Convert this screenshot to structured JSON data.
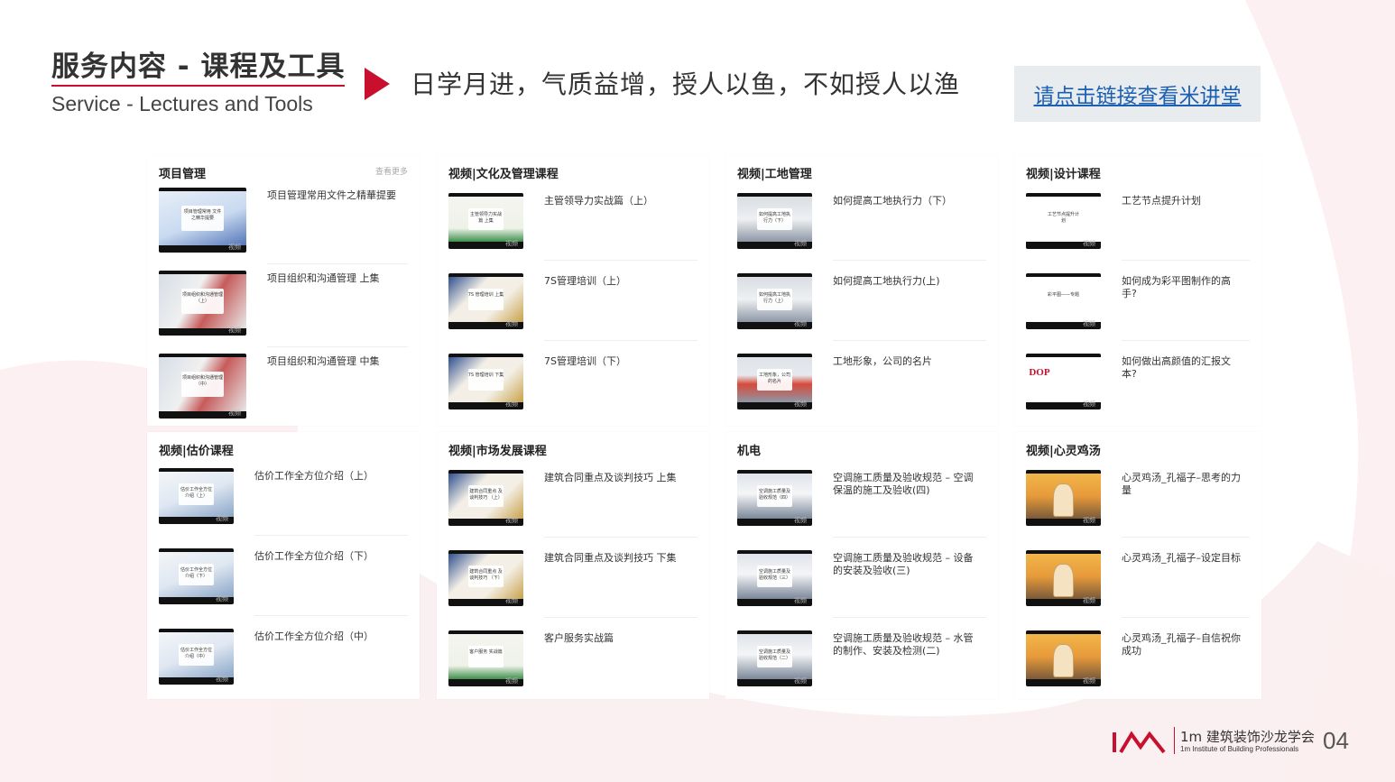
{
  "header": {
    "title_cn": "服务内容 - 课程及工具",
    "title_en": "Service - Lectures and Tools",
    "slogan": "日学月进，气质益增，授人以鱼，不如授人以渔",
    "link_text": "请点击链接查看米讲堂"
  },
  "colors": {
    "accent": "#c8102e",
    "link": "#1a5fb4",
    "wave": "#fbeef0"
  },
  "panels": [
    {
      "title": "项目管理",
      "more": "查看更多",
      "items": [
        {
          "title": "项目管理常用文件之精華提要",
          "thumb_text": "项目管理常用 文件之精华提要",
          "tag": "视频",
          "theme": "blue"
        },
        {
          "title": "项目组织和沟通管理 上集",
          "thumb_text": "项目组织和沟通管理 （上）",
          "tag": "视频",
          "theme": "collage"
        },
        {
          "title": "项目组织和沟通管理 中集",
          "thumb_text": "项目组织和沟通管理 （中）",
          "tag": "视频",
          "theme": "collage"
        }
      ]
    },
    {
      "title": "视频|文化及管理课程",
      "items": [
        {
          "title": "主管领导力实战篇（上）",
          "thumb_text": "主管领导力实战篇 上集",
          "tag": "视频",
          "theme": "green"
        },
        {
          "title": "7S管理培训（上）",
          "thumb_text": "7S 管理培训 上集",
          "tag": "视频",
          "theme": "gear"
        },
        {
          "title": "7S管理培训（下）",
          "thumb_text": "7S 管理培训 下集",
          "tag": "视频",
          "theme": "gear"
        }
      ]
    },
    {
      "title": "视频|工地管理",
      "items": [
        {
          "title": "如何提高工地执行力（下）",
          "thumb_text": "如何提高工地执行力（下）",
          "tag": "视频",
          "theme": "site"
        },
        {
          "title": "如何提高工地执行力(上)",
          "thumb_text": "如何提高工地执行力（上）",
          "tag": "视频",
          "theme": "site"
        },
        {
          "title": "工地形象，公司的名片",
          "thumb_text": "工地形象，公司的名片",
          "tag": "视频",
          "theme": "site-red"
        }
      ]
    },
    {
      "title": "视频|设计课程",
      "items": [
        {
          "title": "工艺节点提升计划",
          "thumb_text": "工艺节点提升计划",
          "tag": "视频",
          "theme": "white"
        },
        {
          "title": "如何成为彩平图制作的高手?",
          "thumb_text": "彩平图——专题",
          "tag": "视频",
          "theme": "white"
        },
        {
          "title": "如何做出高颜值的汇报文本?",
          "thumb_text": "DOP",
          "tag": "视频",
          "theme": "white-dop"
        }
      ]
    },
    {
      "title": "视频|估价课程",
      "items": [
        {
          "title": "估价工作全方位介绍（上）",
          "thumb_text": "估价工作全方位介绍（上）",
          "tag": "视频",
          "theme": "calc"
        },
        {
          "title": "估价工作全方位介绍（下）",
          "thumb_text": "估价工作全方位介绍（下）",
          "tag": "视频",
          "theme": "calc"
        },
        {
          "title": "估价工作全方位介绍（中）",
          "thumb_text": "估价工作全方位介绍（中）",
          "tag": "视频",
          "theme": "calc"
        }
      ]
    },
    {
      "title": "视频|市场发展课程",
      "items": [
        {
          "title": "建筑合同重点及谈判技巧 上集",
          "thumb_text": "建筑合同重点 及谈判技巧 （上）",
          "tag": "视频",
          "theme": "gear"
        },
        {
          "title": "建筑合同重点及谈判技巧 下集",
          "thumb_text": "建筑合同重点 及谈判技巧 （下）",
          "tag": "视频",
          "theme": "gear"
        },
        {
          "title": "客户服务实战篇",
          "thumb_text": "客户服务 实战篇",
          "tag": "视频",
          "theme": "green"
        }
      ]
    },
    {
      "title": "机电",
      "items": [
        {
          "title": "空调施工质量及验收规范 – 空调保温的施工及验收(四)",
          "thumb_text": "空调施工质量及验收规范（四）",
          "tag": "视频",
          "theme": "ac"
        },
        {
          "title": "空调施工质量及验收规范 – 设备的安装及验收(三)",
          "thumb_text": "空调施工质量及验收规范（三）",
          "tag": "视频",
          "theme": "ac"
        },
        {
          "title": "空调施工质量及验收规范 – 水管的制作、安装及检测(二)",
          "thumb_text": "空调施工质量及验收规范（二）",
          "tag": "视频",
          "theme": "ac"
        }
      ]
    },
    {
      "title": "视频|心灵鸡汤",
      "items": [
        {
          "title": "心灵鸡汤_孔福子–思考的力量",
          "thumb_text": "",
          "tag": "视频",
          "theme": "cartoon"
        },
        {
          "title": "心灵鸡汤_孔福子–设定目标",
          "thumb_text": "",
          "tag": "视频",
          "theme": "cartoon"
        },
        {
          "title": "心灵鸡汤_孔福子–自信祝你成功",
          "thumb_text": "",
          "tag": "视频",
          "theme": "cartoon"
        }
      ]
    }
  ],
  "footer": {
    "org_cn": "1m 建筑装饰沙龙学会",
    "org_en": "1m Institute of Building Professionals",
    "page": "04",
    "logo_icon": "iai-logo-icon"
  }
}
